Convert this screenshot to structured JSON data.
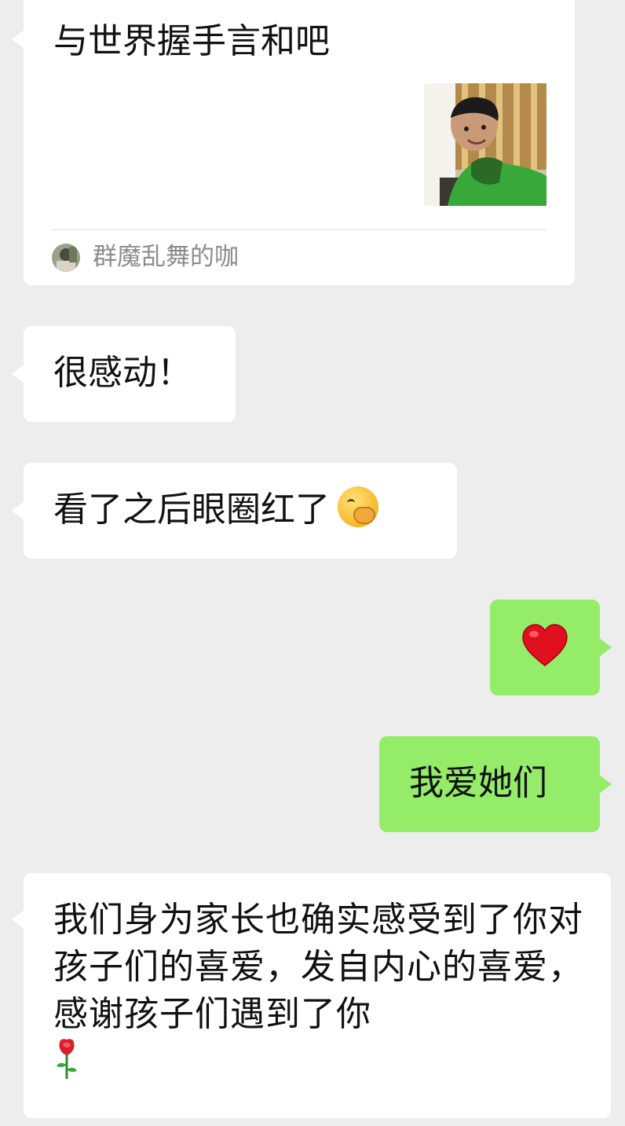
{
  "messages": {
    "card": {
      "title": "与世界握手言和吧",
      "source": "群魔乱舞的咖"
    },
    "m2": "很感动！",
    "m3": "看了之后眼圈红了",
    "m5": "我爱她们",
    "m6": "我们身为家长也确实感受到了你对孩子们的喜爱，发自内心的喜爱，感谢孩子们遇到了你"
  },
  "icons": {
    "m3_emoji": "face-with-hand-over-mouth-icon",
    "m4_emoji": "red-heart-icon",
    "m6_emoji": "rose-icon"
  },
  "colors": {
    "background": "#ededed",
    "incoming": "#ffffff",
    "outgoing": "#95ec69"
  }
}
